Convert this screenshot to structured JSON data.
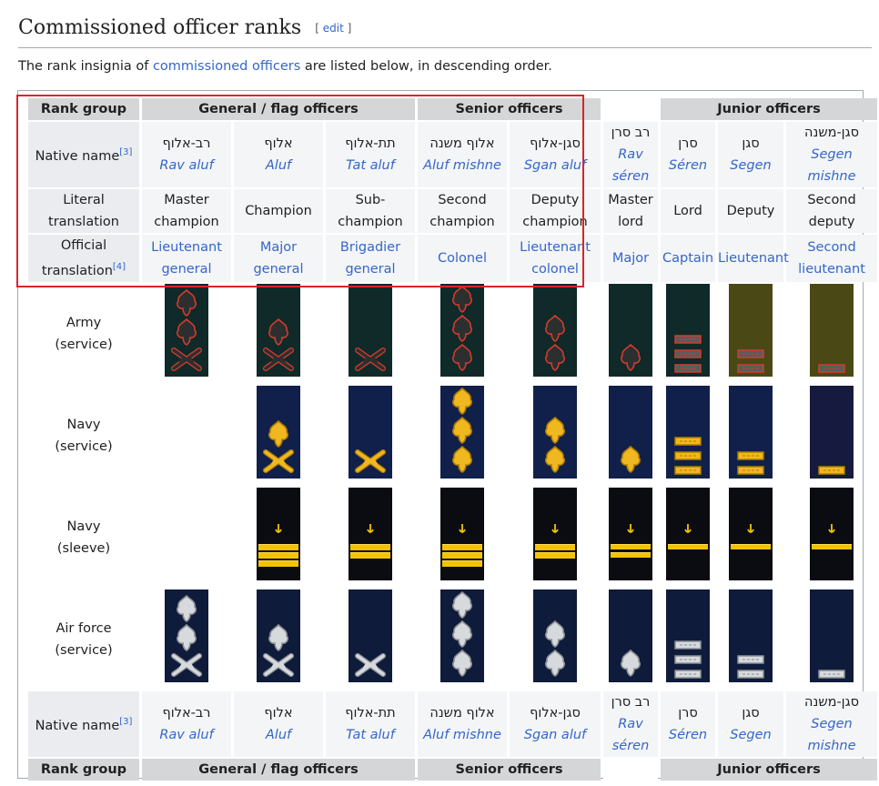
{
  "section": {
    "title": "Commissioned officer ranks",
    "edit_label": "edit",
    "edit_open": "[ ",
    "edit_close": " ]"
  },
  "intro": {
    "before": "The rank insignia of ",
    "link": "commissioned officers",
    "after": " are listed below, in descending order."
  },
  "table": {
    "rank_group_label": "Rank group",
    "groups": [
      "General / flag officers",
      "Senior officers",
      "Junior officers"
    ],
    "native_name_label": "Native name",
    "native_name_ref": "[3]",
    "literal_label": "Literal translation",
    "official_label": "Official translation",
    "official_ref": "[4]",
    "ranks": [
      {
        "hebrew": "רב-אלוף",
        "translit": "Rav aluf",
        "literal": "Master champion",
        "official": "Lieutenant general"
      },
      {
        "hebrew": "אלוף",
        "translit": "Aluf",
        "literal": "Champion",
        "official": "Major general"
      },
      {
        "hebrew": "תת-אלוף",
        "translit": "Tat aluf",
        "literal": "Sub-champion",
        "official": "Brigadier general"
      },
      {
        "hebrew": "אלוף משנה",
        "translit": "Aluf mishne",
        "literal": "Second champion",
        "official": "Colonel"
      },
      {
        "hebrew": "סגן-אלוף",
        "translit": "Sgan aluf",
        "literal": "Deputy champion",
        "official": "Lieutenant colonel"
      },
      {
        "hebrew": "רב סרן",
        "translit": "Rav séren",
        "literal": "Master lord",
        "official": "Major"
      },
      {
        "hebrew": "סרן",
        "translit": "Séren",
        "literal": "Lord",
        "official": "Captain"
      },
      {
        "hebrew": "סגן",
        "translit": "Segen",
        "literal": "Deputy",
        "official": "Lieutenant"
      },
      {
        "hebrew": "סגן-משנה",
        "translit": "Segen mishne",
        "literal": "Second deputy",
        "official": "Second lieutenant"
      }
    ],
    "insignia_rows": [
      {
        "label": "Army (service)"
      },
      {
        "label": "Navy (service)"
      },
      {
        "label": "Navy (sleeve)"
      },
      {
        "label": "Air force (service)"
      }
    ],
    "colors": {
      "highlight": "#d7262b",
      "army_board": "#0f2a28",
      "army_junior_board": "#4a4916",
      "navy_board": "#10204a",
      "gold": "#f2c400",
      "silver": "#cfd3d6"
    }
  }
}
